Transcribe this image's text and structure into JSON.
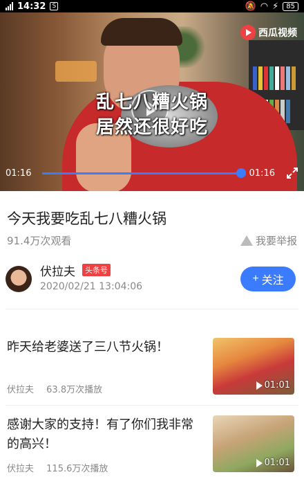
{
  "status_bar": {
    "time": "14:32",
    "app_icon": "S",
    "battery": "85"
  },
  "video": {
    "logo": "西瓜视频",
    "caption_line1": "乱七八糟火锅",
    "caption_line2": "居然还很好吃",
    "current_time": "01:16",
    "total_time": "01:16",
    "progress": 1.0
  },
  "details": {
    "title": "今天我要吃乱七八糟火锅",
    "views": "91.4万次观看",
    "report_label": "我要举报"
  },
  "author": {
    "name": "伏拉夫",
    "badge": "头条号",
    "date": "2020/02/21 13:04:06",
    "follow_label": "关注"
  },
  "recommendations": [
    {
      "title": "昨天给老婆送了三八节火锅！",
      "author": "伏拉夫",
      "plays": "63.8万次播放",
      "duration": "01:01"
    },
    {
      "title": "感谢大家的支持！有了你们我非常的高兴！",
      "author": "伏拉夫",
      "plays": "115.6万次播放",
      "duration": "01:01"
    }
  ],
  "colors": {
    "accent": "#3b7cff",
    "badge": "#f04142"
  }
}
